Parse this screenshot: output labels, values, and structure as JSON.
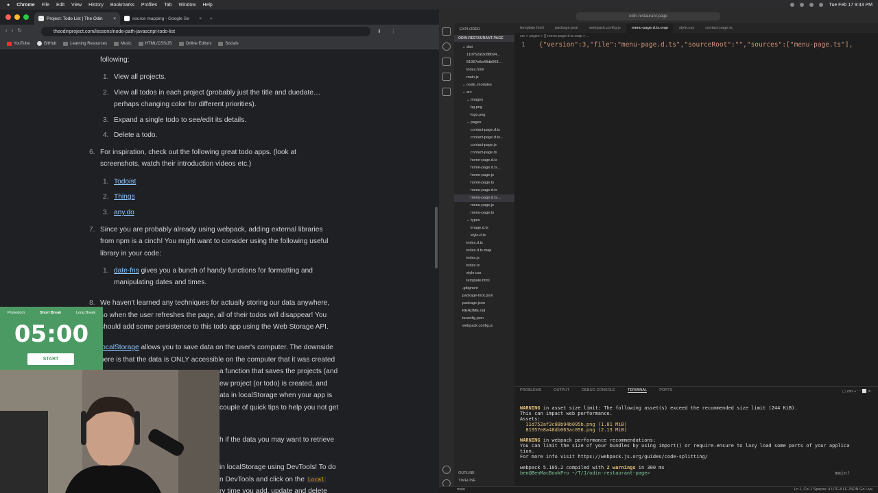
{
  "menubar": {
    "apple": "",
    "app": "Chrome",
    "items": [
      "File",
      "Edit",
      "View",
      "History",
      "Bookmarks",
      "Profiles",
      "Tab",
      "Window",
      "Help"
    ],
    "clock": "Tue Feb 17  9:43 PM"
  },
  "chrome": {
    "tabs": [
      "Project: Todo List | The Odin",
      "source mapping - Google Se"
    ],
    "url": "theodinproject.com/lessons/node-path-javascript-todo-list",
    "bookmarks": [
      "YouTube",
      "GitHub",
      "Learning Resources",
      "Music",
      "HTML/CSS/JS",
      "Online Editors",
      "Socials"
    ]
  },
  "article": {
    "l_following": "following:",
    "sub1": [
      "View all projects.",
      "View all todos in each project (probably just the title and duedate…",
      "perhaps changing color for different priorities).",
      "Expand a single todo to see/edit its details.",
      "Delete a todo."
    ],
    "sub1_nums": [
      "1.",
      "2.",
      "3.",
      "4."
    ],
    "p6_num": "6.",
    "p6": [
      "For inspiration, check out the following great todo apps. (look at",
      "screenshots, watch their introduction videos etc.)"
    ],
    "apps": [
      "Todoist",
      "Things",
      "any.do"
    ],
    "apps_nums": [
      "1.",
      "2.",
      "3."
    ],
    "p7_num": "7.",
    "p7": [
      "Since you are probably already using webpack, adding external libraries",
      "from npm is a cinch! You might want to consider using the following useful",
      "library in your code:"
    ],
    "lib_num": "1.",
    "lib_link": "date-fns",
    "lib_text": " gives you a bunch of handy functions for formatting and",
    "lib_text2": "manipulating dates and times.",
    "p8_num": "8.",
    "p8": [
      "We haven't learned any techniques for actually storing our data anywhere,",
      "so when the user refreshes the page, all of their todos will disappear! You",
      "should add some persistence to this todo app using the Web Storage API."
    ],
    "ls_link": "localStorage",
    "ls1": " allows you to save data on the user's computer. The downside",
    "ls2": "here is that the data is ONLY accessible on the computer that it was created",
    "frag": [
      "a function that saves the projects (and",
      "ew project (or todo) is created, and",
      "ata in localStorage when your app is",
      "couple of quick tips to help you not get",
      "h if the data you may want to retrieve",
      "in localStorage using DevTools! To do",
      "n DevTools and click on the",
      "ry time you add, update and delete"
    ],
    "frag_code": "Local"
  },
  "pomodoro": {
    "modes": [
      "Pomodoro",
      "Short Break",
      "Long Break"
    ],
    "time": "05:00",
    "start": "START"
  },
  "vscode": {
    "search": "odin-restaurant-page",
    "explorer_title": "EXPLORER",
    "project": "ODIN-RESTAURANT-PAGE",
    "tree": [
      {
        "n": "dist",
        "d": 1,
        "t": "folder"
      },
      {
        "n": "11d752af3c88b94...",
        "d": 2
      },
      {
        "n": "81957e8a48db063...",
        "d": 2
      },
      {
        "n": "index.html",
        "d": 2
      },
      {
        "n": "main.js",
        "d": 2
      },
      {
        "n": "node_modules",
        "d": 1,
        "t": "folder"
      },
      {
        "n": "src",
        "d": 1,
        "t": "folder"
      },
      {
        "n": "images",
        "d": 2,
        "t": "folder"
      },
      {
        "n": "bg.png",
        "d": 3
      },
      {
        "n": "logo.png",
        "d": 3
      },
      {
        "n": "pages",
        "d": 2,
        "t": "folder"
      },
      {
        "n": "contact-page.d.ts",
        "d": 3
      },
      {
        "n": "contact-page.d.ts...",
        "d": 3
      },
      {
        "n": "contact-page.js",
        "d": 3
      },
      {
        "n": "contact-page.ts",
        "d": 3
      },
      {
        "n": "home-page.d.ts",
        "d": 3
      },
      {
        "n": "home-page.d.ts...",
        "d": 3
      },
      {
        "n": "home-page.js",
        "d": 3
      },
      {
        "n": "home-page.ts",
        "d": 3
      },
      {
        "n": "menu-page.d.ts",
        "d": 3
      },
      {
        "n": "menu-page.d.ts....",
        "d": 3,
        "sel": true
      },
      {
        "n": "menu-page.js",
        "d": 3
      },
      {
        "n": "menu-page.ts",
        "d": 3
      },
      {
        "n": "types",
        "d": 2,
        "t": "folder"
      },
      {
        "n": "image.d.ts",
        "d": 3
      },
      {
        "n": "style.d.ts",
        "d": 3
      },
      {
        "n": "index.d.ts",
        "d": 2
      },
      {
        "n": "index.d.ts.map",
        "d": 2
      },
      {
        "n": "index.js",
        "d": 2
      },
      {
        "n": "index.ts",
        "d": 2
      },
      {
        "n": "style.css",
        "d": 2
      },
      {
        "n": "template.html",
        "d": 2
      },
      {
        "n": ".gitignore",
        "d": 1
      },
      {
        "n": "package-lock.json",
        "d": 1
      },
      {
        "n": "package.json",
        "d": 1
      },
      {
        "n": "README.md",
        "d": 1
      },
      {
        "n": "tsconfig.json",
        "d": 1
      },
      {
        "n": "webpack.config.js",
        "d": 1
      }
    ],
    "tabs": [
      "template.html",
      "package.json",
      "webpack.config.js",
      "menu-page.d.ts.map",
      "style.css",
      "contact-page.ts"
    ],
    "active_tab": 3,
    "breadcrumb": "src > pages > {} menu-page.d.ts.map > ...",
    "code_ln": "1",
    "code": "{\"version\":3,\"file\":\"menu-page.d.ts\",\"sourceRoot\":\"\",\"sources\":[\"menu-page.ts\"],",
    "panel_tabs": [
      "PROBLEMS",
      "OUTPUT",
      "DEBUG CONSOLE",
      "TERMINAL",
      "PORTS"
    ],
    "panel_active": 3,
    "term_shell": "zsh",
    "terminal": [
      {
        "c": "warn",
        "t": "WARNING"
      },
      {
        "c": "",
        "t": " in asset size limit: The following asset(s) exceed the recommended size limit (244 KiB)."
      },
      {
        "c": "",
        "t": "This can impact web performance."
      },
      {
        "c": "",
        "t": "Assets:"
      },
      {
        "c": "yl",
        "t": "  11d752af3c88b94b095b.png (1.81 MiB)"
      },
      {
        "c": "yl",
        "t": "  81957e8a48db063ac056.png (2.13 MiB)"
      }
    ],
    "terminal2": [
      "You can limit the size of your bundles by using import() or require.ensure to lazy load some parts of your applica",
      "tion.",
      "For more info visit https://webpack.js.org/guides/code-splitting/"
    ],
    "term_warn2": " in webpack performance recommendations:",
    "term_compiled_a": "webpack 5.105.2 compiled with ",
    "term_compiled_b": "2 warnings",
    "term_compiled_c": " in 300 ms",
    "prompt": "ben@BenMacBookPro ~/T/J/odin-restaurant-page> ",
    "outline": "OUTLINE",
    "timeline": "TIMELINE",
    "status_left": "main",
    "status_right": "Ln 1, Col 1   Spaces: 4   UTF-8   LF   JSON   Go Live",
    "term_right": "main!"
  }
}
